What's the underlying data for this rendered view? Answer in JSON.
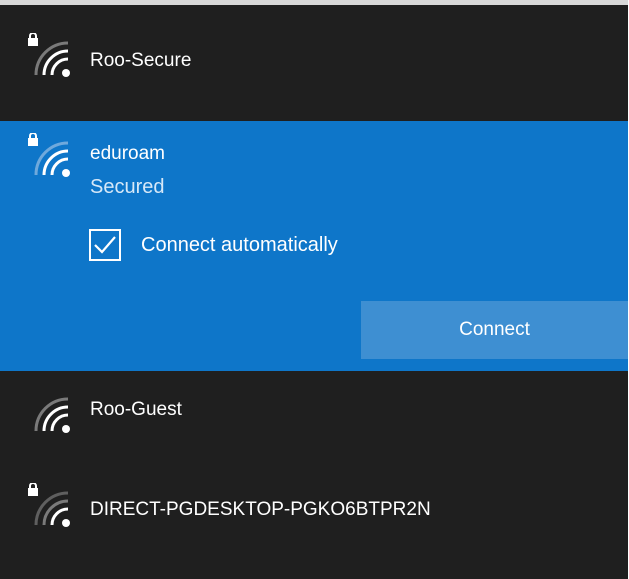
{
  "networks": [
    {
      "ssid": "Roo-Secure",
      "secured": true,
      "icon": "wifi-secure-icon"
    },
    {
      "ssid": "eduroam",
      "status": "Secured",
      "secured": true,
      "selected": true,
      "icon": "wifi-secure-icon",
      "connect_automatically": {
        "label": "Connect automatically",
        "checked": true
      },
      "connect_button": "Connect"
    },
    {
      "ssid": "Roo-Guest",
      "secured": false,
      "icon": "wifi-icon"
    },
    {
      "ssid": "DIRECT-PGDESKTOP-PGKO6BTPR2N",
      "secured": true,
      "icon": "wifi-secure-icon"
    }
  ],
  "colors": {
    "panel_background": "#1f1f1f",
    "selected_background": "#0e76c9",
    "button_background": "#3e8fd2",
    "top_border": "#d8d8d8",
    "text": "#ffffff",
    "secondary_text": "#d6e8f8"
  }
}
